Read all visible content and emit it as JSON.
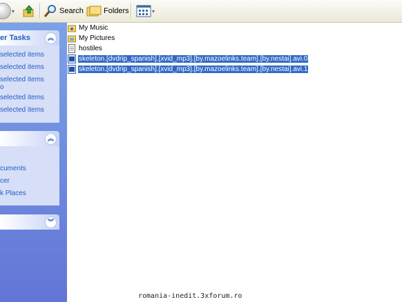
{
  "toolbar": {
    "search_label": "Search",
    "folders_label": "Folders",
    "icons": [
      "back-icon",
      "up-folder-icon",
      "search-icon",
      "folders-icon",
      "views-icon"
    ]
  },
  "task_pane": {
    "box1": {
      "title": "er Tasks",
      "links": [
        "selected items",
        "selected items",
        "selected items",
        "o",
        "selected items",
        "selected items"
      ]
    },
    "box2": {
      "links": [
        "cuments",
        "cer",
        "k Places"
      ]
    }
  },
  "files": [
    {
      "name": "My Music",
      "icon": "folder-icon",
      "selected": false
    },
    {
      "name": "My Pictures",
      "icon": "folder-icon",
      "selected": false
    },
    {
      "name": "hostiles",
      "icon": "text-file-icon",
      "selected": false
    },
    {
      "name": "skeleton.[dvdrip_spanish].[xvid_mp3].[by.mazoelinks.team].[by.nestai].avi.0",
      "icon": "video-file-icon",
      "selected": true
    },
    {
      "name": "skeleton.[dvdrip_spanish].[xvid_mp3].[by.mazoelinks.team].[by.nestai].avi.1",
      "icon": "video-file-icon",
      "selected": true
    }
  ],
  "watermark": "romania-inedit.3xforum.ro",
  "colors": {
    "selection": "#316ac5",
    "taskpane": "#6375d6",
    "link": "#215dc6"
  }
}
